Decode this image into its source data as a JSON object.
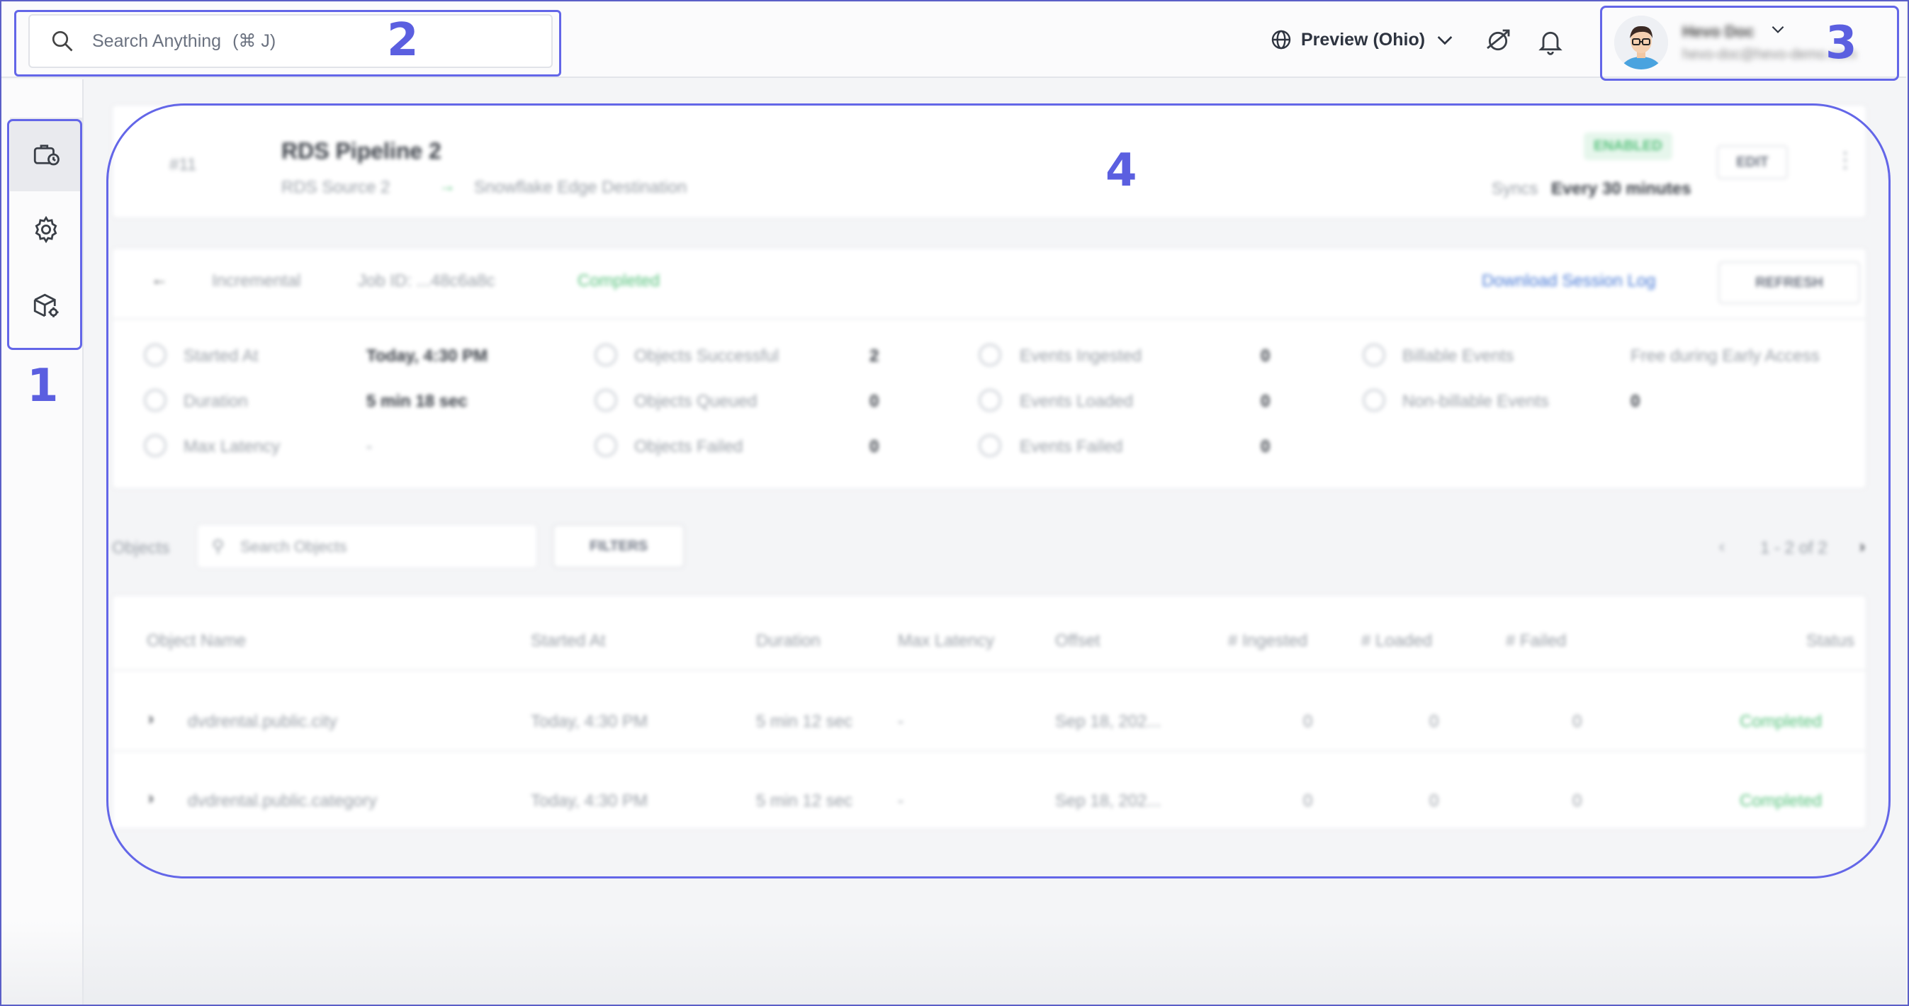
{
  "header": {
    "search_placeholder": "Search Anything",
    "search_shortcut": "(⌘ J)",
    "region_label": "Preview (Ohio)",
    "user_name": "Hevo Doc",
    "user_email": "hevo-doc@hevo-demo.com"
  },
  "annotations": {
    "n1": "1",
    "n2": "2",
    "n3": "3",
    "n4": "4"
  },
  "pipeline": {
    "id": "#11",
    "name": "RDS Pipeline 2",
    "source": "RDS Source 2",
    "destination": "Snowflake Edge Destination",
    "status": "ENABLED",
    "sync_label": "Syncs",
    "sync_value": "Every 30 minutes",
    "edit_label": "EDIT"
  },
  "job": {
    "mode": "Incremental",
    "job_id": "Job ID: ...48c6a8c",
    "status": "Completed",
    "download_label": "Download Session Log",
    "refresh_label": "REFRESH",
    "stats": [
      {
        "label": "Started At",
        "value": "Today, 4:30 PM"
      },
      {
        "label": "Duration",
        "value": "5 min 18 sec"
      },
      {
        "label": "Max Latency",
        "value": "-"
      },
      {
        "label": "Objects Successful",
        "value": "2"
      },
      {
        "label": "Objects Queued",
        "value": "0"
      },
      {
        "label": "Objects Failed",
        "value": "0"
      },
      {
        "label": "Events Ingested",
        "value": "0"
      },
      {
        "label": "Events Loaded",
        "value": "0"
      },
      {
        "label": "Events Failed",
        "value": "0"
      },
      {
        "label": "Billable Events",
        "value": "Free during Early Access"
      },
      {
        "label": "Non-billable Events",
        "value": "0"
      }
    ]
  },
  "objects": {
    "tab_label": "Objects",
    "search_placeholder": "Search Objects",
    "filters_label": "FILTERS",
    "pagination": "1 - 2 of 2",
    "columns": [
      "Object Name",
      "Started At",
      "Duration",
      "Max Latency",
      "Offset",
      "# Ingested",
      "# Loaded",
      "# Failed",
      "Status"
    ],
    "rows": [
      {
        "name": "dvdrental.public.city",
        "started": "Today, 4:30 PM",
        "duration": "5 min 12 sec",
        "latency": "-",
        "offset": "Sep 18, 202...",
        "ingested": "0",
        "loaded": "0",
        "failed": "0",
        "status": "Completed"
      },
      {
        "name": "dvdrental.public.category",
        "started": "Today, 4:30 PM",
        "duration": "5 min 12 sec",
        "latency": "-",
        "offset": "Sep 18, 202...",
        "ingested": "0",
        "loaded": "0",
        "failed": "0",
        "status": "Completed"
      }
    ]
  },
  "colors": {
    "annotation": "#6366e8",
    "success": "#58c27d",
    "link": "#4a7bd6"
  }
}
